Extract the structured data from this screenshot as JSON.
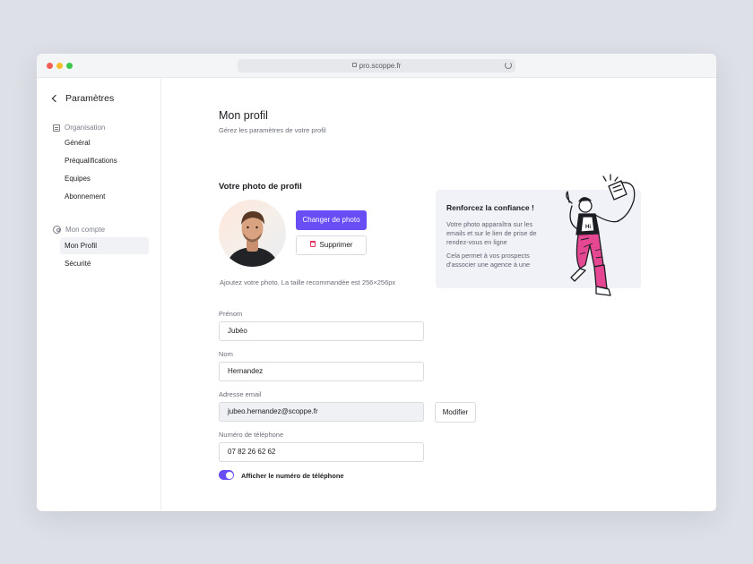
{
  "browser": {
    "url": "pro.scoppe.fr"
  },
  "sidebar": {
    "back_title": "Paramètres",
    "organisation": {
      "heading": "Organisation",
      "items": [
        {
          "label": "Général"
        },
        {
          "label": "Préqualifications"
        },
        {
          "label": "Equipes"
        },
        {
          "label": "Abonnement"
        }
      ]
    },
    "account": {
      "heading": "Mon compte",
      "items": [
        {
          "label": "Mon Profil",
          "active": true
        },
        {
          "label": "Sécurité"
        }
      ]
    }
  },
  "main": {
    "title": "Mon profil",
    "subtitle": "Gérez les paramètres de votre profil",
    "photo": {
      "title": "Votre photo de profil",
      "change_label": "Changer de photo",
      "delete_label": "Supprimer",
      "hint": "Ajoutez votre photo. La taille recommandée est 256×256px"
    },
    "info_card": {
      "title": "Renforcez la confiance !",
      "text_1": "Votre photo apparaîtra sur les emails et sur le lien de prise de rendez-vous en ligne",
      "text_2": "Cela permet à vos prospects d'associer une agence à une",
      "illustration_text": "Hi"
    },
    "form": {
      "first_name": {
        "label": "Prénom",
        "value": "Jubéo"
      },
      "last_name": {
        "label": "Nom",
        "value": "Hernandez"
      },
      "email": {
        "label": "Adresse email",
        "value": "jubeo.hernandez@scoppe.fr",
        "edit_label": "Modifier"
      },
      "phone": {
        "label": "Numéro de téléphone",
        "value": "07 82 26 62 62"
      },
      "show_phone": {
        "label": "Afficher le numéro de téléphone",
        "enabled": true
      }
    }
  },
  "colors": {
    "accent": "#6a4ef5",
    "danger": "#e0345a",
    "illustration_pink": "#e64793"
  }
}
